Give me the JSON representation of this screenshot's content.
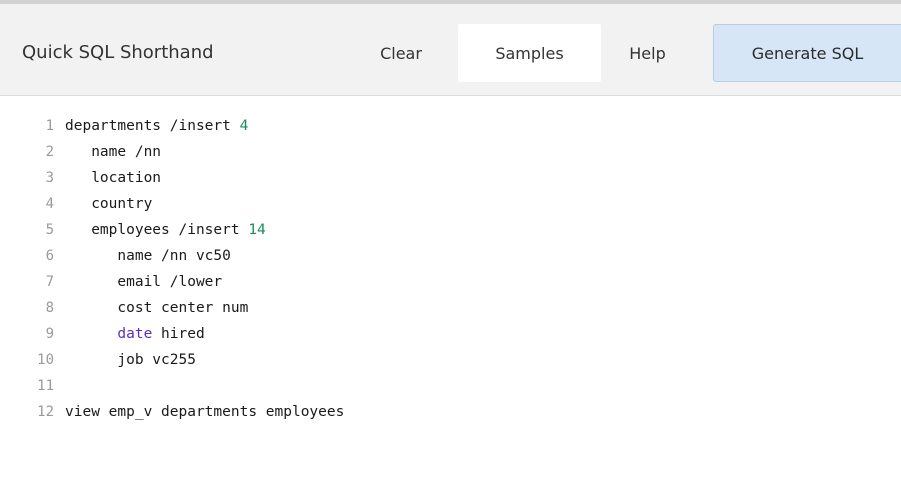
{
  "toolbar": {
    "title": "Quick SQL Shorthand",
    "clear_label": "Clear",
    "samples_label": "Samples",
    "help_label": "Help",
    "generate_label": "Generate SQL"
  },
  "editor": {
    "lines": [
      {
        "number": "1",
        "segments": [
          {
            "text": "departments /insert ",
            "kind": "plain"
          },
          {
            "text": "4",
            "kind": "num"
          }
        ]
      },
      {
        "number": "2",
        "segments": [
          {
            "text": "   name /nn",
            "kind": "plain"
          }
        ]
      },
      {
        "number": "3",
        "segments": [
          {
            "text": "   location",
            "kind": "plain"
          }
        ]
      },
      {
        "number": "4",
        "segments": [
          {
            "text": "   country",
            "kind": "plain"
          }
        ]
      },
      {
        "number": "5",
        "segments": [
          {
            "text": "   employees /insert ",
            "kind": "plain"
          },
          {
            "text": "14",
            "kind": "num"
          }
        ]
      },
      {
        "number": "6",
        "segments": [
          {
            "text": "      name /nn vc50",
            "kind": "plain"
          }
        ]
      },
      {
        "number": "7",
        "segments": [
          {
            "text": "      email /lower",
            "kind": "plain"
          }
        ]
      },
      {
        "number": "8",
        "segments": [
          {
            "text": "      cost center num",
            "kind": "plain"
          }
        ]
      },
      {
        "number": "9",
        "segments": [
          {
            "text": "      ",
            "kind": "plain"
          },
          {
            "text": "date",
            "kind": "kw"
          },
          {
            "text": " hired",
            "kind": "plain"
          }
        ]
      },
      {
        "number": "10",
        "segments": [
          {
            "text": "      job vc255",
            "kind": "plain"
          }
        ]
      },
      {
        "number": "11",
        "segments": []
      },
      {
        "number": "12",
        "segments": [
          {
            "text": "view emp_v departments employees",
            "kind": "plain"
          }
        ]
      }
    ]
  },
  "colors": {
    "toolbar_bg": "#f2f2f2",
    "generate_bg": "#d6e6f6",
    "number_token": "#1b8a5a",
    "keyword_token": "#5b2fb8",
    "line_number": "#9a9a9a"
  }
}
